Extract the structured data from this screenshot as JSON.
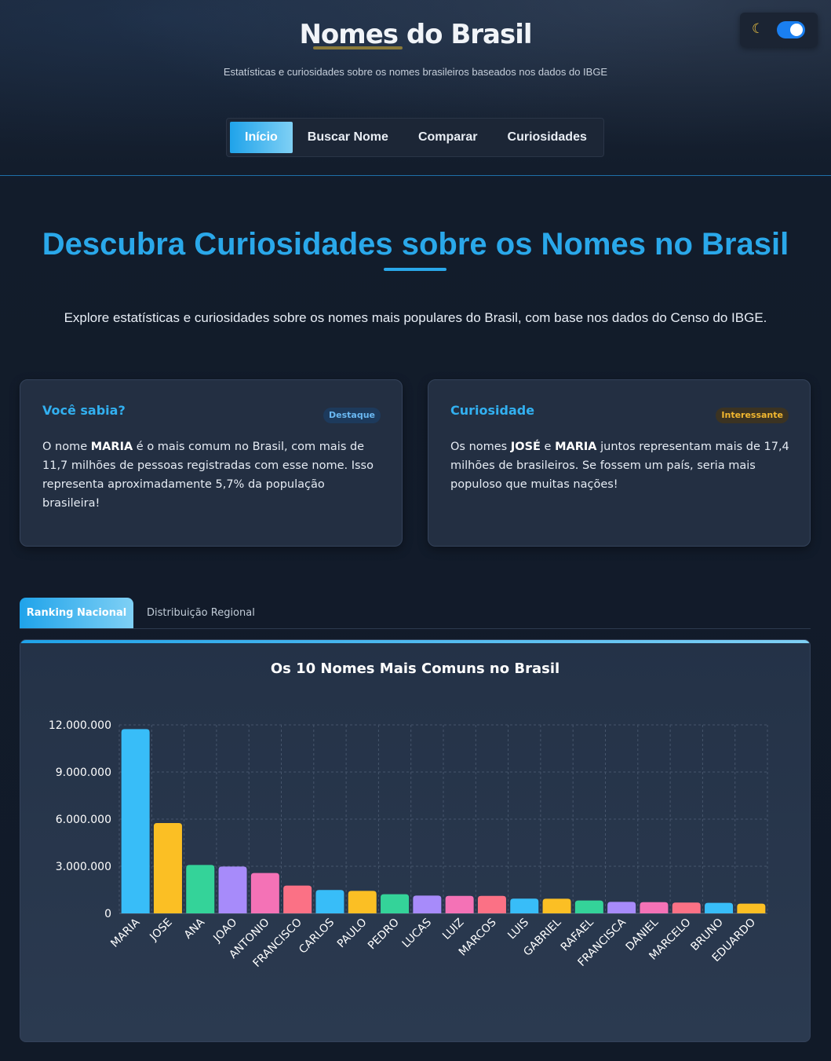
{
  "header": {
    "title": "Nomes do Brasil",
    "subtitle": "Estatísticas e curiosidades sobre os nomes brasileiros baseados nos dados do IBGE",
    "theme_icon": "moon-icon",
    "theme_toggle_on": true
  },
  "nav": {
    "items": [
      {
        "label": "Início",
        "active": true
      },
      {
        "label": "Buscar Nome",
        "active": false
      },
      {
        "label": "Comparar",
        "active": false
      },
      {
        "label": "Curiosidades",
        "active": false
      }
    ]
  },
  "hero": {
    "title": "Descubra Curiosidades sobre os Nomes no Brasil",
    "description": "Explore estatísticas e curiosidades sobre os nomes mais populares do Brasil, com base nos dados do Censo do IBGE."
  },
  "cards": [
    {
      "title": "Você sabia?",
      "badge": "Destaque",
      "text_before": "O nome ",
      "highlight1": "MARIA",
      "text_middle": " é o mais comum no Brasil, com mais de 11,7 milhões de pessoas registradas com esse nome. Isso representa aproximadamente 5,7% da população brasileira!"
    },
    {
      "title": "Curiosidade",
      "badge": "Interessante",
      "text_before": "Os nomes ",
      "highlight1": "JOSÉ",
      "text_middle": " e ",
      "highlight2": "MARIA",
      "text_after": " juntos representam mais de 17,4 milhões de brasileiros. Se fossem um país, seria mais populoso que muitas nações!"
    }
  ],
  "tabs": [
    {
      "label": "Ranking Nacional",
      "active": true
    },
    {
      "label": "Distribuição Regional",
      "active": false
    }
  ],
  "chart_data": {
    "type": "bar",
    "title": "Os 10 Nomes Mais Comuns no Brasil",
    "categories": [
      "MARIA",
      "JOSE",
      "ANA",
      "JOAO",
      "ANTONIO",
      "FRANCISCO",
      "CARLOS",
      "PAULO",
      "PEDRO",
      "LUCAS",
      "LUIZ",
      "MARCOS",
      "LUIS",
      "GABRIEL",
      "RAFAEL",
      "FRANCISCA",
      "DANIEL",
      "MARCELO",
      "BRUNO",
      "EDUARDO"
    ],
    "values": [
      11730000,
      5750000,
      3080000,
      2980000,
      2570000,
      1770000,
      1490000,
      1430000,
      1220000,
      1130000,
      1110000,
      1110000,
      940000,
      930000,
      820000,
      730000,
      710000,
      690000,
      670000,
      620000
    ],
    "yticks": [
      "0",
      "3.000.000",
      "6.000.000",
      "9.000.000",
      "12.000.000"
    ],
    "ylim": [
      0,
      12000000
    ],
    "grid": true,
    "colors": [
      "#38bdf8",
      "#fbbf24",
      "#34d399",
      "#a78bfa",
      "#f472b6",
      "#fb7185"
    ]
  }
}
